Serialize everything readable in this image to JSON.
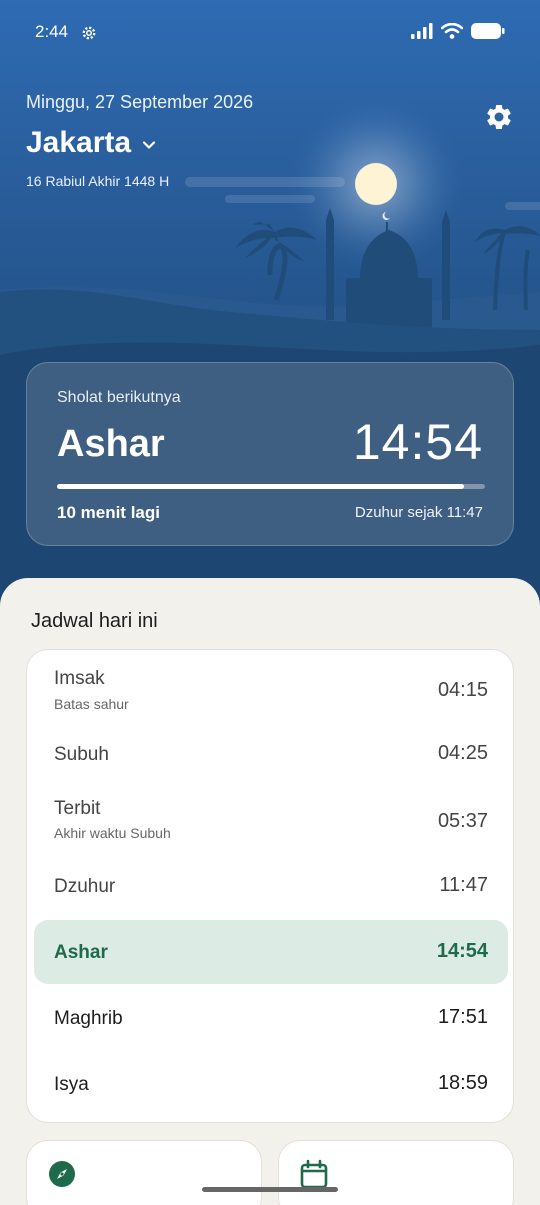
{
  "status": {
    "time": "2:44"
  },
  "header": {
    "date": "Minggu, 27 September 2026",
    "city": "Jakarta",
    "hijri_date": "16 Rabiul Akhir 1448 H"
  },
  "next_prayer": {
    "label": "Sholat berikutnya",
    "name": "Ashar",
    "time": "14:54",
    "remaining": "10 menit lagi",
    "since": "Dzuhur sejak 11:47",
    "progress": 0.95
  },
  "schedule": {
    "title": "Jadwal hari ini",
    "rows": [
      {
        "name": "Imsak",
        "sub": "Batas sahur",
        "time": "04:15"
      },
      {
        "name": "Subuh",
        "sub": "",
        "time": "04:25"
      },
      {
        "name": "Terbit",
        "sub": "Akhir waktu Subuh",
        "time": "05:37"
      },
      {
        "name": "Dzuhur",
        "sub": "",
        "time": "11:47"
      },
      {
        "name": "Ashar",
        "sub": "",
        "time": "14:54"
      },
      {
        "name": "Maghrib",
        "sub": "",
        "time": "17:51"
      },
      {
        "name": "Isya",
        "sub": "",
        "time": "18:59"
      }
    ]
  },
  "tiles": {
    "left_icon": "compass-icon",
    "right_icon": "calendar-icon"
  },
  "colors": {
    "accent_green": "#1e6b4b",
    "active_row_bg": "#dcebe3",
    "sky": "#2e6bb3"
  }
}
